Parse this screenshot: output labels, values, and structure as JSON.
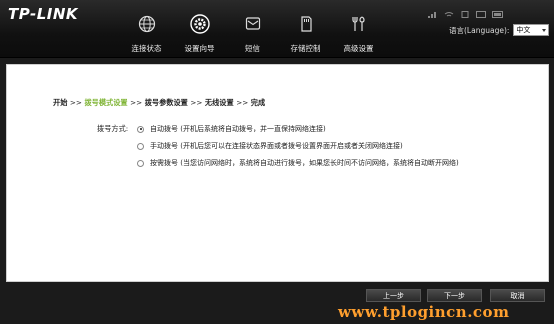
{
  "brand": {
    "logo_text": "TP-LINK"
  },
  "nav": [
    {
      "label": "连接状态",
      "icon": "globe-icon"
    },
    {
      "label": "设置向导",
      "icon": "gear-icon"
    },
    {
      "label": "短信",
      "icon": "envelope-icon"
    },
    {
      "label": "存储控制",
      "icon": "sd-card-icon"
    },
    {
      "label": "高级设置",
      "icon": "tools-icon"
    }
  ],
  "language": {
    "label": "语言(Language):",
    "selected": "中文"
  },
  "breadcrumb": {
    "step1": "开始",
    "sep": ">>",
    "step2": "拨号模式设置",
    "step3": "拨号参数设置",
    "step4": "无线设置",
    "step5": "完成"
  },
  "dial_mode": {
    "label": "拨号方式:",
    "options": [
      {
        "text": "自动拨号 (开机后系统将自动拨号，并一直保持网络连接)",
        "checked": true
      },
      {
        "text": "手动拨号 (开机后您可以在连接状态界面或者拨号设置界面开启或者关闭网络连接)",
        "checked": false
      },
      {
        "text": "按需拨号 (当您访问网络时，系统将自动进行拨号，如果您长时间不访问网络，系统将自动断开网络)",
        "checked": false
      }
    ]
  },
  "buttons": {
    "prev": "上一步",
    "next": "下一步",
    "cancel": "取消"
  },
  "watermark": "www.tplogincn.com",
  "colors": {
    "accent_green": "#7fb435",
    "watermark": "#ff9f2e"
  }
}
